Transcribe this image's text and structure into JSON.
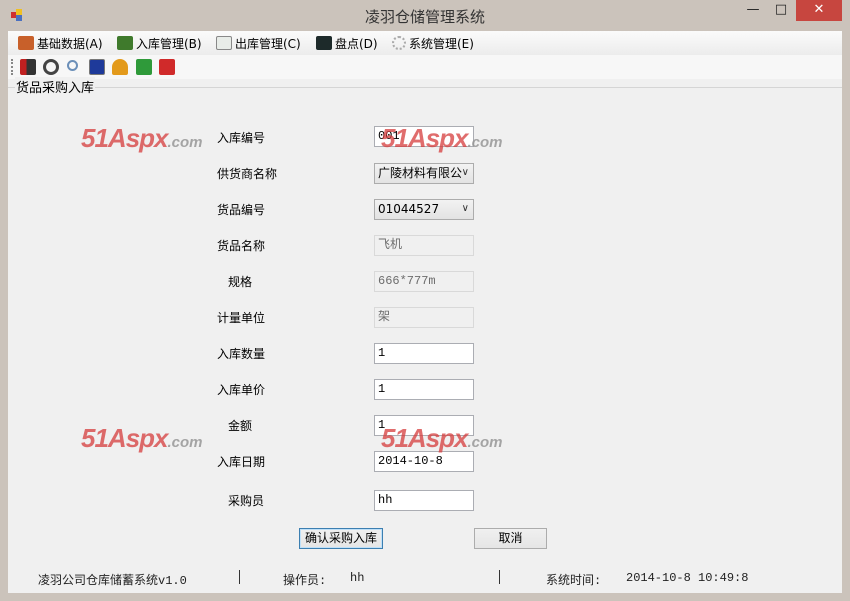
{
  "window": {
    "title": "凌羽仓储管理系统",
    "minimize": "—",
    "maximize": "□",
    "close": "✕"
  },
  "menu": [
    {
      "label": "基础数据(A)",
      "icon": "box-icon",
      "color": "#c8602a"
    },
    {
      "label": "入库管理(B)",
      "icon": "truck-icon",
      "color": "#3f7a2c"
    },
    {
      "label": "出库管理(C)",
      "icon": "window-icon",
      "color": "#c9d3c9"
    },
    {
      "label": "盘点(D)",
      "icon": "console-icon",
      "color": "#1d2a2a"
    },
    {
      "label": "系统管理(E)",
      "icon": "gear-icon",
      "color": "#c0c0c0"
    }
  ],
  "toolbar": [
    {
      "icon": "exit-arrow-icon",
      "color": "#b01e1e"
    },
    {
      "icon": "refresh-icon",
      "color": "#444444"
    },
    {
      "icon": "search-icon",
      "color": "#6b8fb8"
    },
    {
      "icon": "monitor-icon",
      "color": "#1e3a9a"
    },
    {
      "icon": "bell-icon",
      "color": "#e39a1b"
    },
    {
      "icon": "switch-icon",
      "color": "#2f9a3a"
    },
    {
      "icon": "power-icon",
      "color": "#d02a2a"
    }
  ],
  "group_title": "货品采购入库",
  "form": {
    "receipt_no": {
      "label": "入库编号",
      "value": "001"
    },
    "supplier": {
      "label": "供货商名称",
      "value": "广陵材料有限公"
    },
    "item_code": {
      "label": "货品编号",
      "value": "01044527"
    },
    "item_name": {
      "label": "货品名称",
      "value": "飞机"
    },
    "spec": {
      "label": "规格",
      "value": "666*777m"
    },
    "unit": {
      "label": "计量单位",
      "value": "架"
    },
    "quantity": {
      "label": "入库数量",
      "value": "1"
    },
    "unit_price": {
      "label": "入库单价",
      "value": "1"
    },
    "amount": {
      "label": "金额",
      "value": "1"
    },
    "date": {
      "label": "入库日期",
      "value": "2014-10-8"
    },
    "buyer": {
      "label": "采购员",
      "value": "hh"
    }
  },
  "buttons": {
    "confirm": "确认采购入库",
    "cancel": "取消"
  },
  "watermark": {
    "main": "51Aspx",
    ".com": ".com"
  },
  "status": {
    "app": "凌羽公司仓库储蓄系统v1.0",
    "operator_label": "操作员:",
    "operator": "hh",
    "time_label": "系统时间:",
    "time": "2014-10-8 10:49:8"
  }
}
